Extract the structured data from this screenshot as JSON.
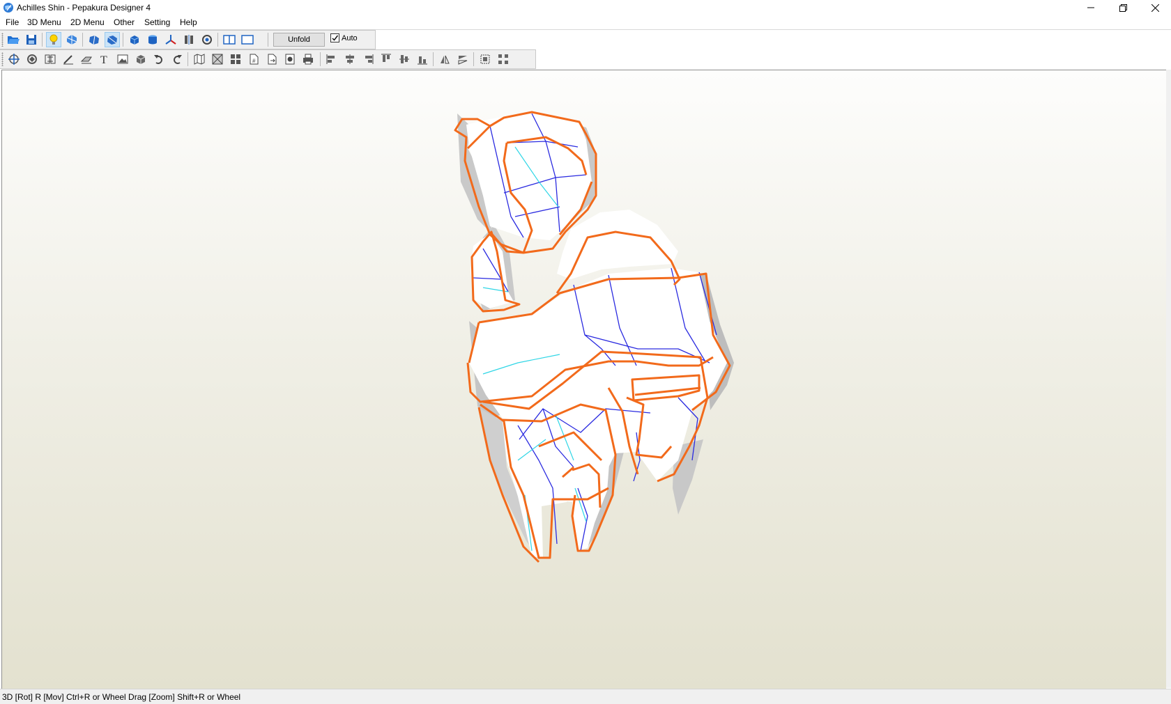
{
  "window": {
    "title": "Achilles Shin - Pepakura Designer 4",
    "app_icon": "pepakura-globe-icon"
  },
  "menu": {
    "items": [
      {
        "label": "File"
      },
      {
        "label": "3D Menu"
      },
      {
        "label": "2D Menu"
      },
      {
        "label": "Other"
      },
      {
        "label": "Setting"
      },
      {
        "label": "Help"
      }
    ]
  },
  "toolbar1": {
    "unfold_label": "Unfold",
    "auto_label": "Auto",
    "auto_checked": true,
    "icons": [
      "open-folder-icon",
      "save-icon",
      "light-bulb-icon",
      "texture-icon",
      "rotate-model-icon",
      "pan-model-icon",
      "solid-icon",
      "cylinder-icon",
      "axis-icon",
      "mirror-icon",
      "view-icon",
      "split-view-icon",
      "single-view-icon"
    ]
  },
  "toolbar2": {
    "icons": [
      "select-icon",
      "rotate-part-icon",
      "join-icon",
      "edit-line-icon",
      "edit-flap-icon",
      "text-icon",
      "image-icon",
      "3d-part-icon",
      "undo-icon",
      "redo-icon",
      "unfold-map-icon",
      "arrange-icon",
      "grid-icon",
      "page-icon",
      "export-icon",
      "print-setup-icon",
      "print-icon",
      "align-left-icon",
      "align-center-h-icon",
      "align-right-icon",
      "align-top-icon",
      "align-center-v-icon",
      "align-bottom-icon",
      "flip-h-icon",
      "flip-v-icon",
      "group-icon",
      "ungroup-icon"
    ]
  },
  "colors": {
    "cut_edge": "#f26a1b",
    "mountain_fold": "#2a2ae0",
    "valley_fold": "#2fd6e6",
    "face": "#ffffff",
    "side_face": "#c9c9c9"
  },
  "status": {
    "text": "3D [Rot] R [Mov] Ctrl+R or Wheel Drag [Zoom] Shift+R or Wheel"
  }
}
